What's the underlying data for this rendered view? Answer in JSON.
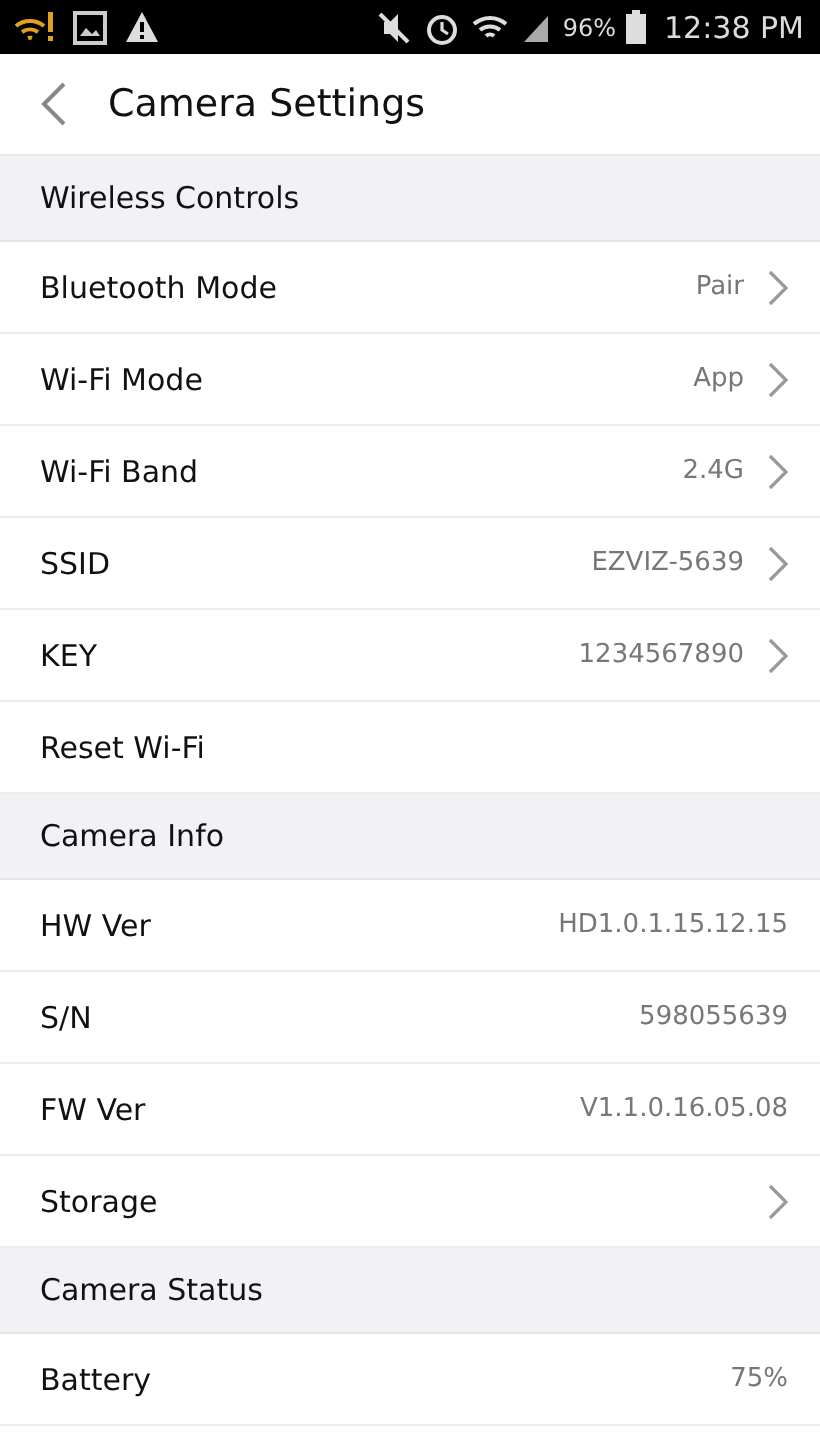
{
  "status_bar": {
    "battery_text": "96%",
    "time": "12:38 PM"
  },
  "header": {
    "title": "Camera Settings"
  },
  "sections": [
    {
      "title": "Wireless Controls",
      "rows": [
        {
          "label": "Bluetooth Mode",
          "value": "Pair",
          "chevron": true
        },
        {
          "label": "Wi-Fi Mode",
          "value": "App",
          "chevron": true
        },
        {
          "label": "Wi-Fi Band",
          "value": "2.4G",
          "chevron": true
        },
        {
          "label": "SSID",
          "value": "EZVIZ-5639",
          "chevron": true
        },
        {
          "label": "KEY",
          "value": "1234567890",
          "chevron": true
        },
        {
          "label": "Reset Wi-Fi",
          "chevron": false
        }
      ]
    },
    {
      "title": "Camera Info",
      "rows": [
        {
          "label": "HW Ver",
          "value": "HD1.0.1.15.12.15",
          "chevron": false
        },
        {
          "label": "S/N",
          "value": "598055639",
          "chevron": false
        },
        {
          "label": "FW Ver",
          "value": "V1.1.0.16.05.08",
          "chevron": false
        },
        {
          "label": "Storage",
          "chevron": true
        }
      ]
    },
    {
      "title": "Camera Status",
      "rows": [
        {
          "label": "Battery",
          "value": "75%",
          "chevron": false
        }
      ]
    }
  ]
}
